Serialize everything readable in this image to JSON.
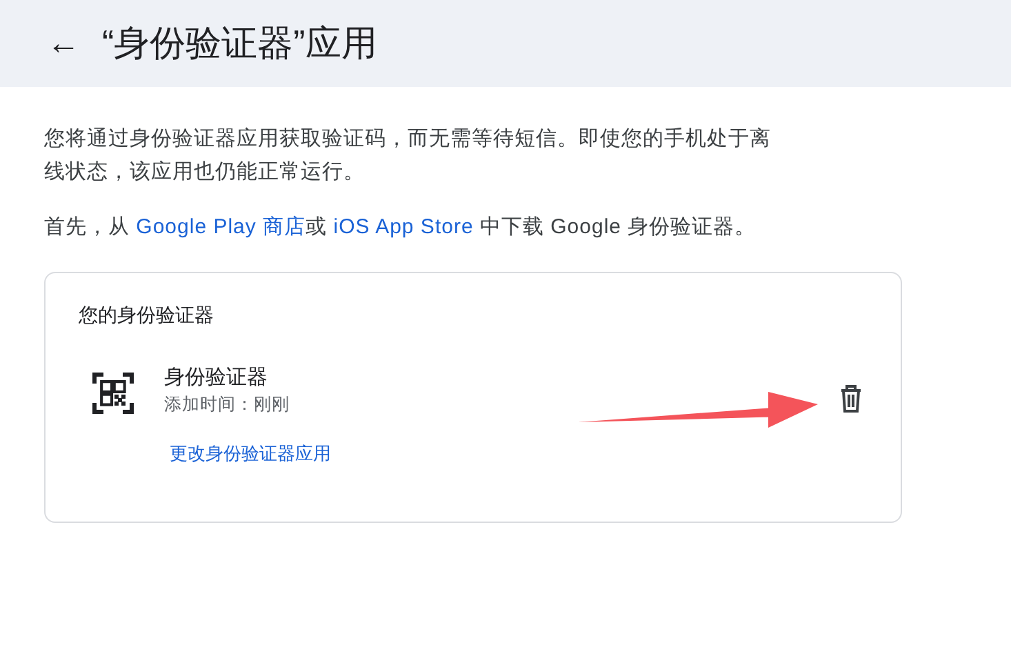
{
  "header": {
    "back": "←",
    "title": "“身份验证器”应用"
  },
  "intro": "您将通过身份验证器应用获取验证码，而无需等待短信。即使您的手机处于离线状态，该应用也仍能正常运行。",
  "download": [
    {
      "kind": "text",
      "text": "首先，从 "
    },
    {
      "kind": "link",
      "text": "Google Play 商店"
    },
    {
      "kind": "text",
      "text": "或 "
    },
    {
      "kind": "link",
      "text": "iOS App Store"
    },
    {
      "kind": "text",
      "text": " 中下载 Google 身份验证器。"
    }
  ],
  "card": {
    "title": "您的身份验证器",
    "app_name": "身份验证器",
    "added": "添加时间：刚刚",
    "change_link": "更改身份验证器应用"
  }
}
